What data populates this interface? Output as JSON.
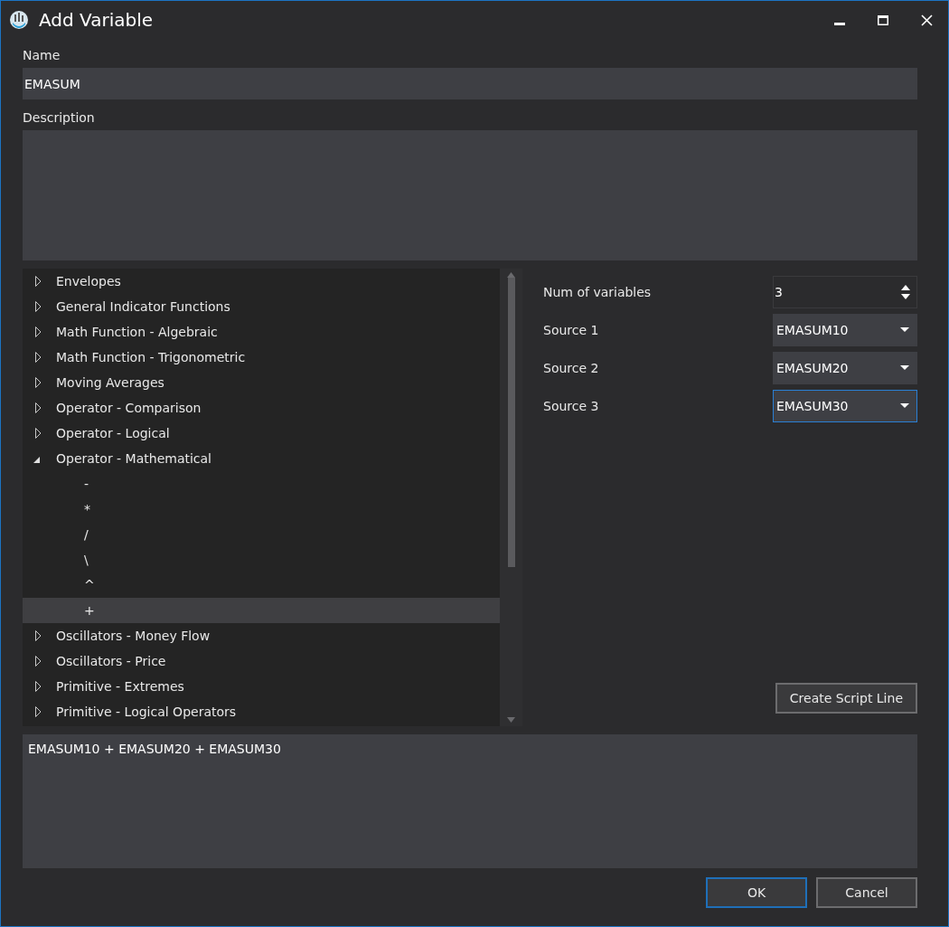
{
  "window": {
    "title": "Add Variable"
  },
  "name": {
    "label": "Name",
    "value": "EMASUM"
  },
  "description": {
    "label": "Description"
  },
  "tree": {
    "items": [
      {
        "label": "Envelopes",
        "expanded": false,
        "selected": false
      },
      {
        "label": "General Indicator Functions",
        "expanded": false,
        "selected": false
      },
      {
        "label": "Math Function - Algebraic",
        "expanded": false,
        "selected": false
      },
      {
        "label": "Math Function - Trigonometric",
        "expanded": false,
        "selected": false
      },
      {
        "label": "Moving Averages",
        "expanded": false,
        "selected": false
      },
      {
        "label": "Operator - Comparison",
        "expanded": false,
        "selected": false
      },
      {
        "label": "Operator - Logical",
        "expanded": false,
        "selected": false
      },
      {
        "label": "Operator - Mathematical",
        "expanded": true,
        "selected": false,
        "children": [
          {
            "label": "-",
            "selected": false
          },
          {
            "label": "*",
            "selected": false
          },
          {
            "label": "/",
            "selected": false
          },
          {
            "label": "\\",
            "selected": false
          },
          {
            "label": "^",
            "selected": false
          },
          {
            "label": "+",
            "selected": true
          }
        ]
      },
      {
        "label": "Oscillators  - Money Flow",
        "expanded": false,
        "selected": false
      },
      {
        "label": "Oscillators - Price",
        "expanded": false,
        "selected": false
      },
      {
        "label": "Primitive - Extremes",
        "expanded": false,
        "selected": false
      },
      {
        "label": "Primitive - Logical Operators",
        "expanded": false,
        "selected": false
      }
    ]
  },
  "num_of_variables": {
    "label": "Num of variables",
    "value": "3"
  },
  "sources": [
    {
      "label": "Source 1",
      "value": "EMASUM10",
      "focused": false
    },
    {
      "label": "Source 2",
      "value": "EMASUM20",
      "focused": false
    },
    {
      "label": "Source 3",
      "value": "EMASUM30",
      "focused": true
    }
  ],
  "create_button": "Create Script Line",
  "script": "EMASUM10 + EMASUM20 + EMASUM30",
  "buttons": [
    {
      "label": "OK",
      "default": true
    },
    {
      "label": "Cancel",
      "default": false
    }
  ]
}
